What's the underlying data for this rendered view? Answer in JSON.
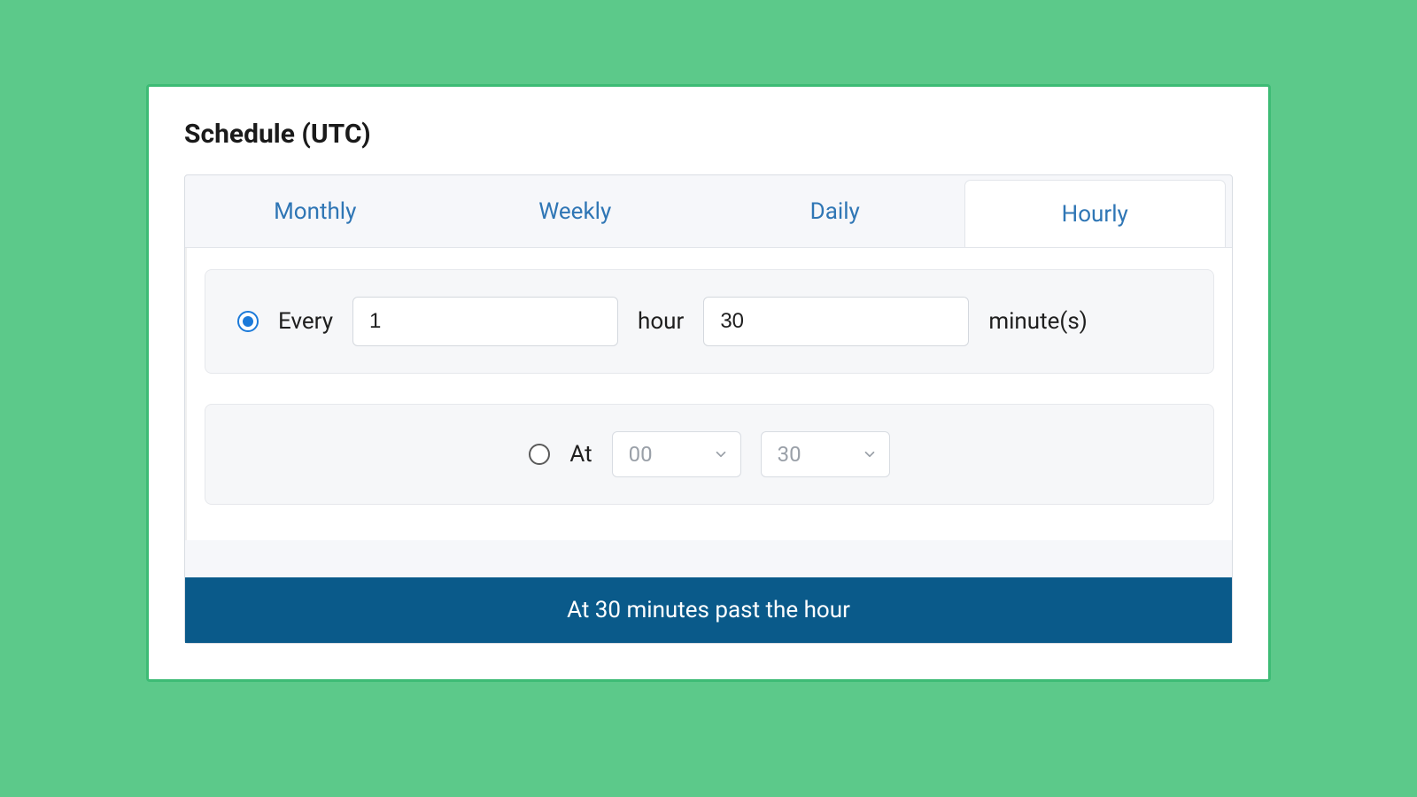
{
  "title": "Schedule (UTC)",
  "tabs": [
    {
      "label": "Monthly",
      "active": false
    },
    {
      "label": "Weekly",
      "active": false
    },
    {
      "label": "Daily",
      "active": false
    },
    {
      "label": "Hourly",
      "active": true
    }
  ],
  "every": {
    "label": "Every",
    "hours_value": "1",
    "hours_label": "hour",
    "minutes_value": "30",
    "minutes_label": "minute(s)",
    "selected": true
  },
  "at": {
    "label": "At",
    "hour_value": "00",
    "minute_value": "30",
    "selected": false
  },
  "summary": "At 30 minutes past the hour"
}
